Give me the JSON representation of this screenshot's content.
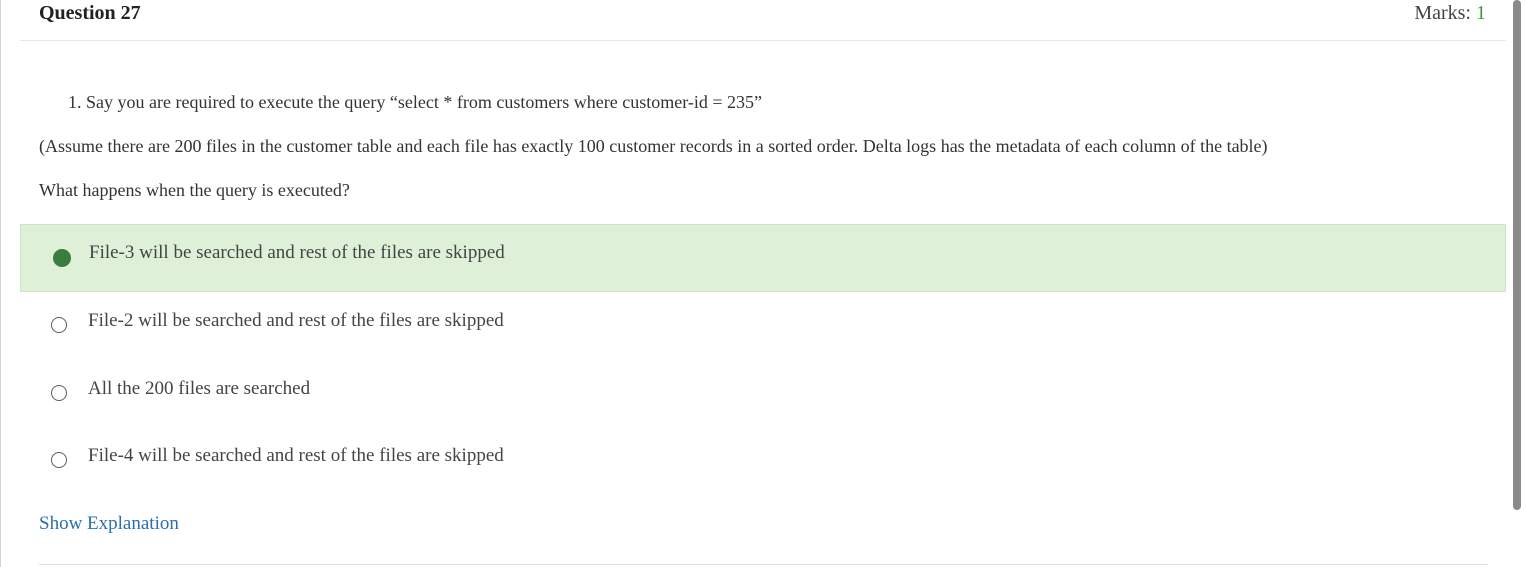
{
  "header": {
    "question_title": "Question 27",
    "marks_label": "Marks: ",
    "marks_value": "1"
  },
  "question": {
    "stem_line_1": "1. Say you are required to execute the query “select * from customers where customer-id = 235”",
    "stem_line_2": "(Assume there are 200 files in the customer table and each file has exactly 100 customer records in a sorted order. Delta logs has the metadata of each column of the table)",
    "stem_line_3": "What happens when the query is executed?"
  },
  "options": [
    {
      "label": "File-3 will be searched and rest of the files are skipped",
      "selected": true
    },
    {
      "label": "File-2 will be searched and rest of the files are skipped",
      "selected": false
    },
    {
      "label": "All the 200 files are searched",
      "selected": false
    },
    {
      "label": "File-4 will be searched and rest of the files are skipped",
      "selected": false
    }
  ],
  "footer": {
    "show_explanation": "Show Explanation"
  },
  "colors": {
    "selected_bg": "#dff0d8",
    "selected_radio": "#3a7d3f",
    "marks_value": "#3c9a3c",
    "link": "#2a6eb0"
  }
}
